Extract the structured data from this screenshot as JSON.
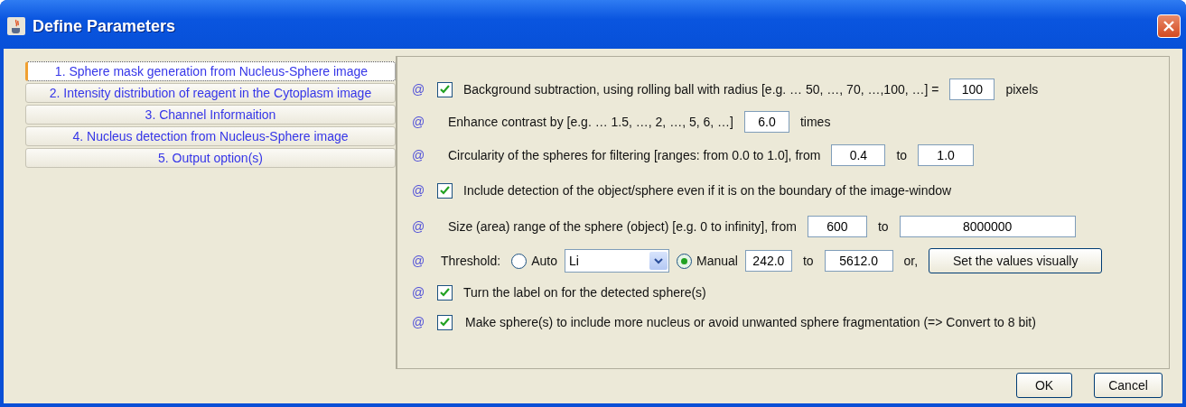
{
  "window": {
    "title": "Define Parameters"
  },
  "tabs": [
    {
      "label": "1. Sphere mask generation from Nucleus-Sphere image",
      "selected": true
    },
    {
      "label": "2. Intensity distribution of reagent in the Cytoplasm image",
      "selected": false
    },
    {
      "label": "3. Channel Informaition",
      "selected": false
    },
    {
      "label": "4. Nucleus detection from Nucleus-Sphere image",
      "selected": false
    },
    {
      "label": "5. Output option(s)",
      "selected": false
    }
  ],
  "rows": [
    {
      "marker": "@",
      "parts": [
        {
          "kind": "checkbox",
          "checked": true
        },
        {
          "kind": "text",
          "text": "Background subtraction, using rolling ball with radius [e.g. … 50, …, 70, …,100, …] ="
        },
        {
          "kind": "field",
          "value": "100"
        },
        {
          "kind": "text",
          "text": "pixels"
        }
      ]
    },
    {
      "marker": "@",
      "parts": [
        {
          "kind": "text",
          "text": "Enhance contrast by [e.g. … 1.5, …, 2, …, 5, 6, …]"
        },
        {
          "kind": "field",
          "value": "6.0"
        },
        {
          "kind": "text",
          "text": "times"
        }
      ]
    },
    {
      "marker": "@",
      "parts": [
        {
          "kind": "text",
          "text": "Circularity of the spheres for filtering [ranges: from 0.0 to 1.0], from"
        },
        {
          "kind": "field",
          "value": "0.4"
        },
        {
          "kind": "text",
          "text": "to"
        },
        {
          "kind": "field",
          "value": "1.0"
        }
      ]
    },
    {
      "marker": "@",
      "parts": [
        {
          "kind": "checkbox",
          "checked": true
        },
        {
          "kind": "text",
          "text": "Include detection of the object/sphere even if it is on the boundary of the image-window"
        }
      ]
    },
    {
      "marker": "@",
      "parts": [
        {
          "kind": "text",
          "text": "Size (area) range of the sphere (object) [e.g. 0 to infinity], from"
        },
        {
          "kind": "field",
          "value": "600"
        },
        {
          "kind": "text",
          "text": "to"
        },
        {
          "kind": "field",
          "value": "8000000"
        }
      ]
    },
    {
      "marker": "@",
      "parts": [
        {
          "kind": "text",
          "text": "Threshold:"
        },
        {
          "kind": "radio",
          "selected": false,
          "label": "Auto"
        },
        {
          "kind": "select",
          "value": "Li"
        },
        {
          "kind": "radio",
          "selected": true,
          "label": "Manual"
        },
        {
          "kind": "field",
          "value": "242.0"
        },
        {
          "kind": "text",
          "text": "to"
        },
        {
          "kind": "field",
          "value": "5612.0"
        },
        {
          "kind": "text",
          "text": "or,"
        },
        {
          "kind": "button",
          "label": "Set the values visually"
        }
      ]
    },
    {
      "marker": "@",
      "parts": [
        {
          "kind": "checkbox",
          "checked": true
        },
        {
          "kind": "text",
          "text": "Turn the label on for the detected sphere(s)"
        }
      ]
    },
    {
      "marker": "@",
      "parts": [
        {
          "kind": "checkbox",
          "checked": true
        },
        {
          "kind": "text",
          "text": "Make sphere(s) to include more nucleus or avoid unwanted sphere fragmentation (=> Convert to 8 bit)"
        }
      ]
    }
  ],
  "buttons": [
    "OK",
    "Cancel"
  ]
}
